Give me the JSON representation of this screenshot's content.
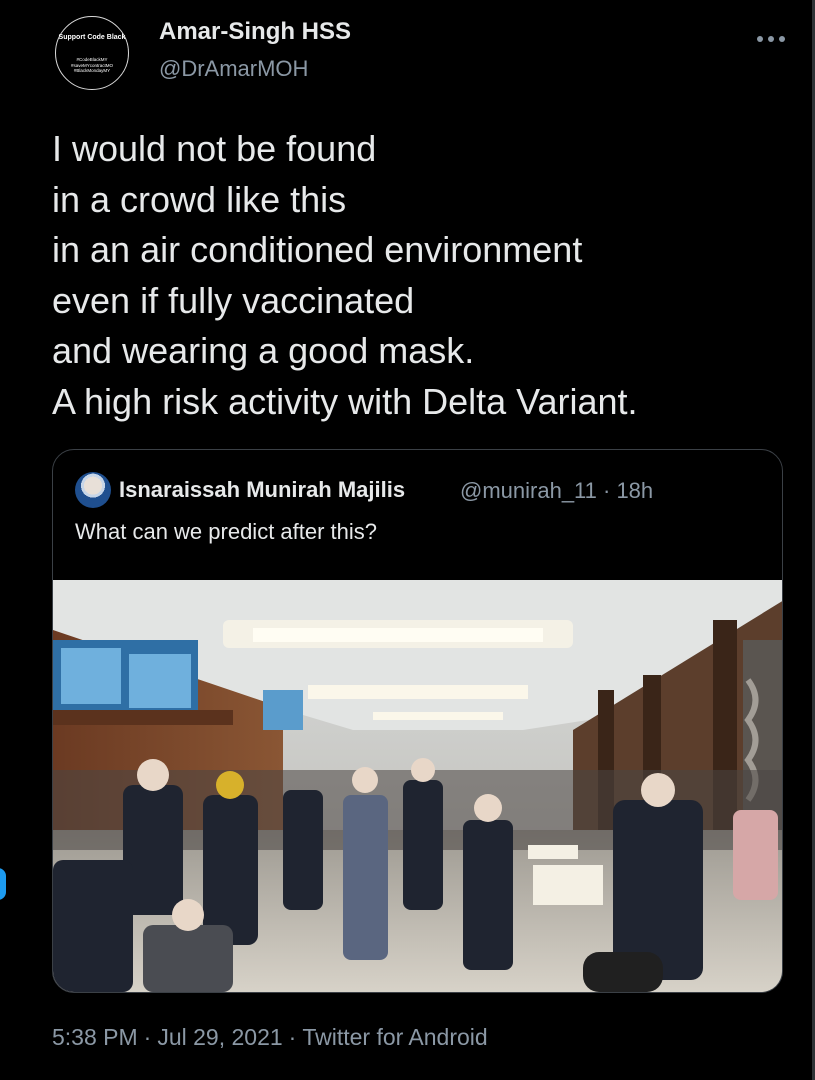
{
  "tweet": {
    "author": {
      "display_name": "Amar-Singh HSS",
      "handle": "@DrAmarMOH",
      "avatar_text_main": "Support Code Black",
      "avatar_text_tags": "#CodeBlackMY #saveMYcontractMO #BlackMondayMY"
    },
    "more_icon": "more-horizontal-icon",
    "text_lines": [
      "I would not be found",
      "in a crowd like this",
      "in an air conditioned environment",
      "even if fully vaccinated",
      "and wearing a good mask.",
      "A high risk activity with Delta Variant."
    ],
    "footer": {
      "time": "5:38 PM",
      "date": "Jul 29, 2021",
      "source": "Twitter for Android",
      "separator": "·"
    }
  },
  "quote": {
    "author_name": "Isnaraissah Munirah Majilis",
    "handle": "@munirah_11",
    "age": "18h",
    "meta": "@munirah_11 · 18h",
    "text": "What can we predict after this?",
    "photo_description_icon": "photo-crowded-banquet-hall"
  },
  "colors": {
    "background": "#000000",
    "primary_text": "#e7e9ea",
    "secondary_text": "#8b98a5",
    "border": "#3b4046",
    "accent": "#1d9bf0"
  }
}
